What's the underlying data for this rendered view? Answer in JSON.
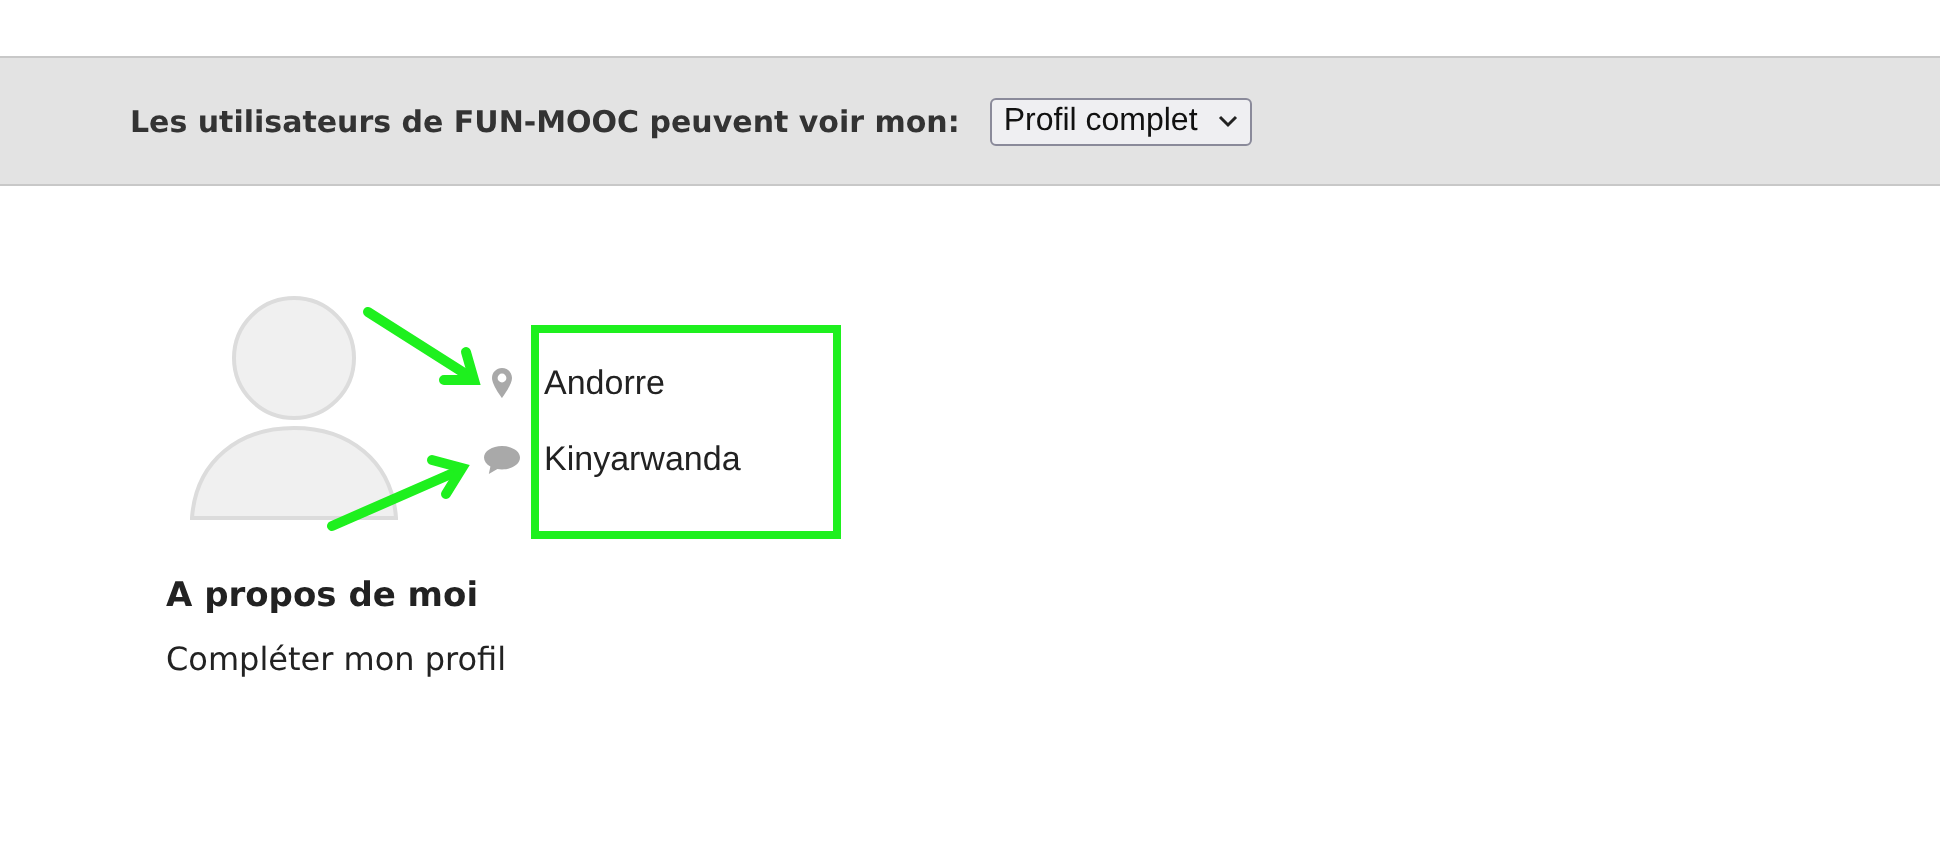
{
  "visibility_bar": {
    "label": "Les utilisateurs de FUN-MOOC peuvent voir mon:",
    "select_value": "Profil complet"
  },
  "profile": {
    "details": [
      {
        "kind": "location",
        "text": "Andorre"
      },
      {
        "kind": "language",
        "text": "Kinyarwanda"
      }
    ],
    "about_heading": "A propos de moi",
    "about_link": "Compléter mon profil"
  }
}
